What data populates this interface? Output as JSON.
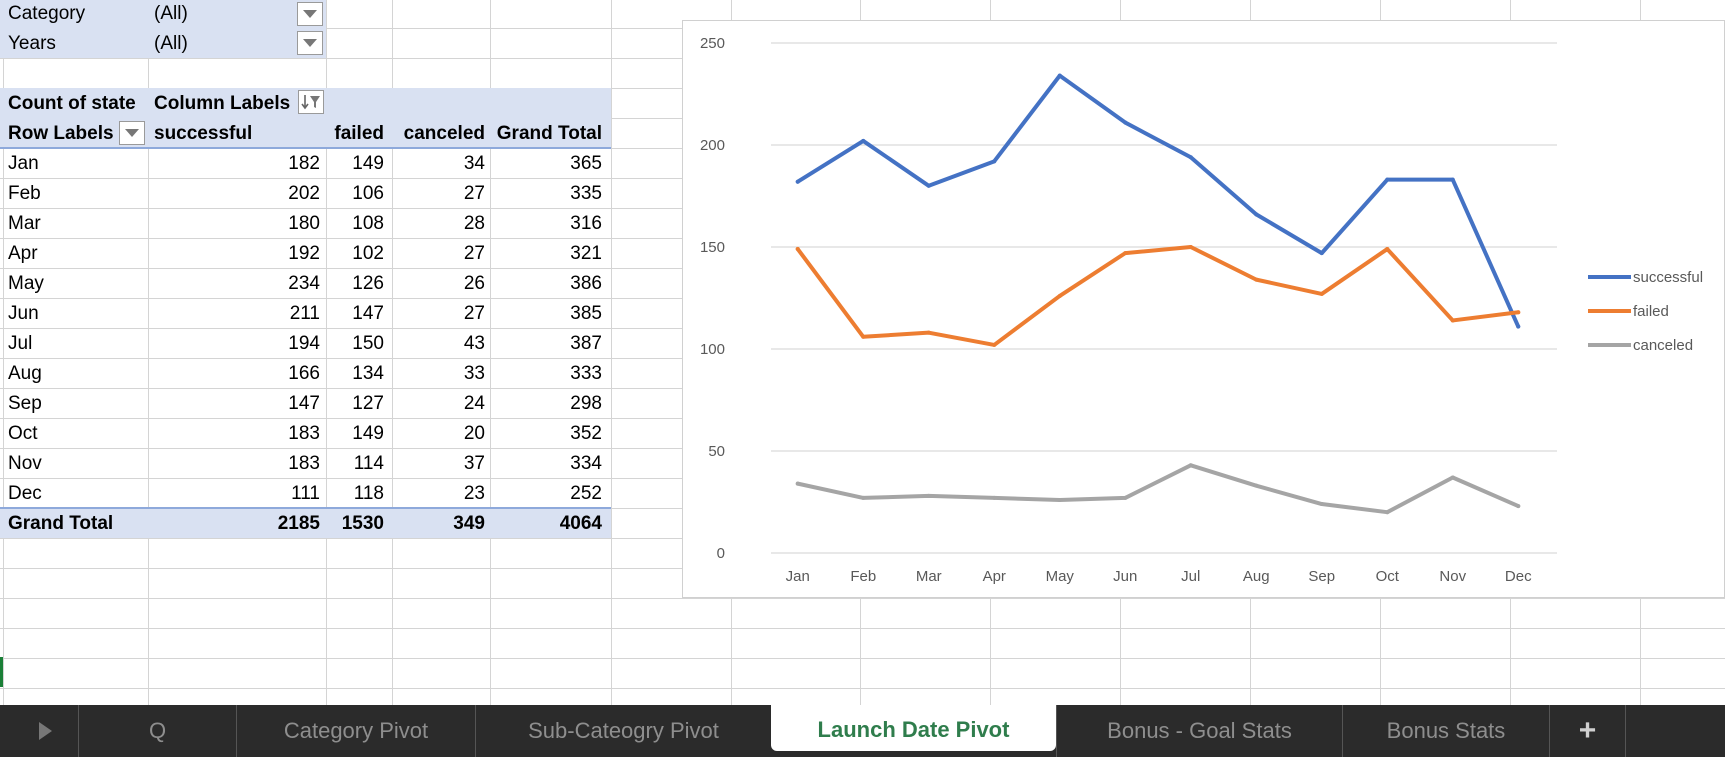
{
  "filters": [
    {
      "label": "Category",
      "value": "(All)"
    },
    {
      "label": "Years",
      "value": "(All)"
    }
  ],
  "pivot": {
    "value_field": "Count of state",
    "column_labels": "Column Labels",
    "row_labels": "Row Labels",
    "columns": [
      "successful",
      "failed",
      "canceled",
      "Grand Total"
    ],
    "rows": [
      {
        "label": "Jan",
        "values": [
          "182",
          "149",
          "34",
          "365"
        ]
      },
      {
        "label": "Feb",
        "values": [
          "202",
          "106",
          "27",
          "335"
        ]
      },
      {
        "label": "Mar",
        "values": [
          "180",
          "108",
          "28",
          "316"
        ]
      },
      {
        "label": "Apr",
        "values": [
          "192",
          "102",
          "27",
          "321"
        ]
      },
      {
        "label": "May",
        "values": [
          "234",
          "126",
          "26",
          "386"
        ]
      },
      {
        "label": "Jun",
        "values": [
          "211",
          "147",
          "27",
          "385"
        ]
      },
      {
        "label": "Jul",
        "values": [
          "194",
          "150",
          "43",
          "387"
        ]
      },
      {
        "label": "Aug",
        "values": [
          "166",
          "134",
          "33",
          "333"
        ]
      },
      {
        "label": "Sep",
        "values": [
          "147",
          "127",
          "24",
          "298"
        ]
      },
      {
        "label": "Oct",
        "values": [
          "183",
          "149",
          "20",
          "352"
        ]
      },
      {
        "label": "Nov",
        "values": [
          "183",
          "114",
          "37",
          "334"
        ]
      },
      {
        "label": "Dec",
        "values": [
          "111",
          "118",
          "23",
          "252"
        ]
      }
    ],
    "total": {
      "label": "Grand Total",
      "values": [
        "2185",
        "1530",
        "349",
        "4064"
      ]
    }
  },
  "chart_data": {
    "type": "line",
    "categories": [
      "Jan",
      "Feb",
      "Mar",
      "Apr",
      "May",
      "Jun",
      "Jul",
      "Aug",
      "Sep",
      "Oct",
      "Nov",
      "Dec"
    ],
    "series": [
      {
        "name": "successful",
        "color": "#4472c4",
        "values": [
          182,
          202,
          180,
          192,
          234,
          211,
          194,
          166,
          147,
          183,
          183,
          111
        ]
      },
      {
        "name": "failed",
        "color": "#ed7d31",
        "values": [
          149,
          106,
          108,
          102,
          126,
          147,
          150,
          134,
          127,
          149,
          114,
          118
        ]
      },
      {
        "name": "canceled",
        "color": "#a5a5a5",
        "values": [
          34,
          27,
          28,
          27,
          26,
          27,
          43,
          33,
          24,
          20,
          37,
          23
        ]
      }
    ],
    "ylim": [
      0,
      250
    ],
    "yticks": [
      0,
      50,
      100,
      150,
      200,
      250
    ],
    "grid": true,
    "legend": "right"
  },
  "tabs": [
    "Q",
    "Category Pivot",
    "Sub-Cateogry Pivot",
    "Launch Date Pivot",
    "Bonus - Goal Stats",
    "Bonus Stats"
  ],
  "active_tab": "Launch Date Pivot",
  "add_sheet_label": "+"
}
